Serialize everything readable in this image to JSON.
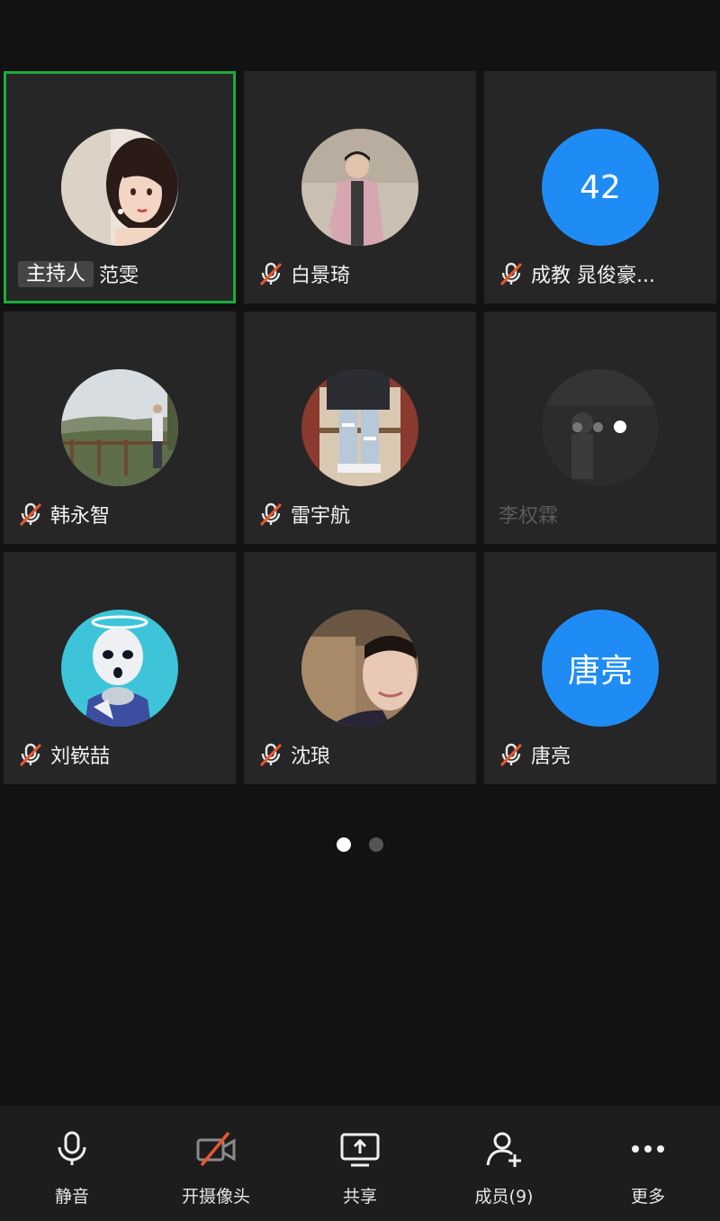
{
  "participants": [
    {
      "name": "范雯",
      "badge": "主持人",
      "avatar_type": "photo",
      "avatar_desc": "anime-girl"
    },
    {
      "name": "白景琦",
      "muted": true,
      "avatar_type": "photo",
      "avatar_desc": "man-pink-jacket"
    },
    {
      "name": "成教 晁俊豪...",
      "muted": true,
      "avatar_type": "initials",
      "initials": "42"
    },
    {
      "name": "韩永智",
      "muted": true,
      "avatar_type": "photo",
      "avatar_desc": "landscape-railing"
    },
    {
      "name": "雷宇航",
      "muted": true,
      "avatar_type": "photo",
      "avatar_desc": "ripped-jeans"
    },
    {
      "name": "李权霖",
      "muted": false,
      "loading": true,
      "avatar_type": "photo",
      "avatar_desc": "dark-figure"
    },
    {
      "name": "刘嵚喆",
      "muted": true,
      "avatar_type": "photo",
      "avatar_desc": "doll-halo"
    },
    {
      "name": "沈琅",
      "muted": true,
      "avatar_type": "photo",
      "avatar_desc": "selfie"
    },
    {
      "name": "唐亮",
      "muted": true,
      "avatar_type": "initials",
      "initials": "唐亮"
    }
  ],
  "pager": {
    "pages": 2,
    "current": 1
  },
  "toolbar": {
    "mute_label": "静音",
    "camera_label": "开摄像头",
    "share_label": "共享",
    "members_label": "成员(9)",
    "more_label": "更多"
  },
  "colors": {
    "background": "#121212",
    "tile": "#262626",
    "active_border": "#1aad3b",
    "initials_avatar": "#1f8cf5",
    "muted_icon_slash": "#e8572f",
    "toolbar": "#1d1d1d"
  },
  "icons": {
    "mute": "mic-muted-icon",
    "mic": "microphone-icon",
    "camera": "camera-off-icon",
    "share": "screen-share-icon",
    "members": "add-member-icon",
    "more": "more-dots-icon"
  }
}
